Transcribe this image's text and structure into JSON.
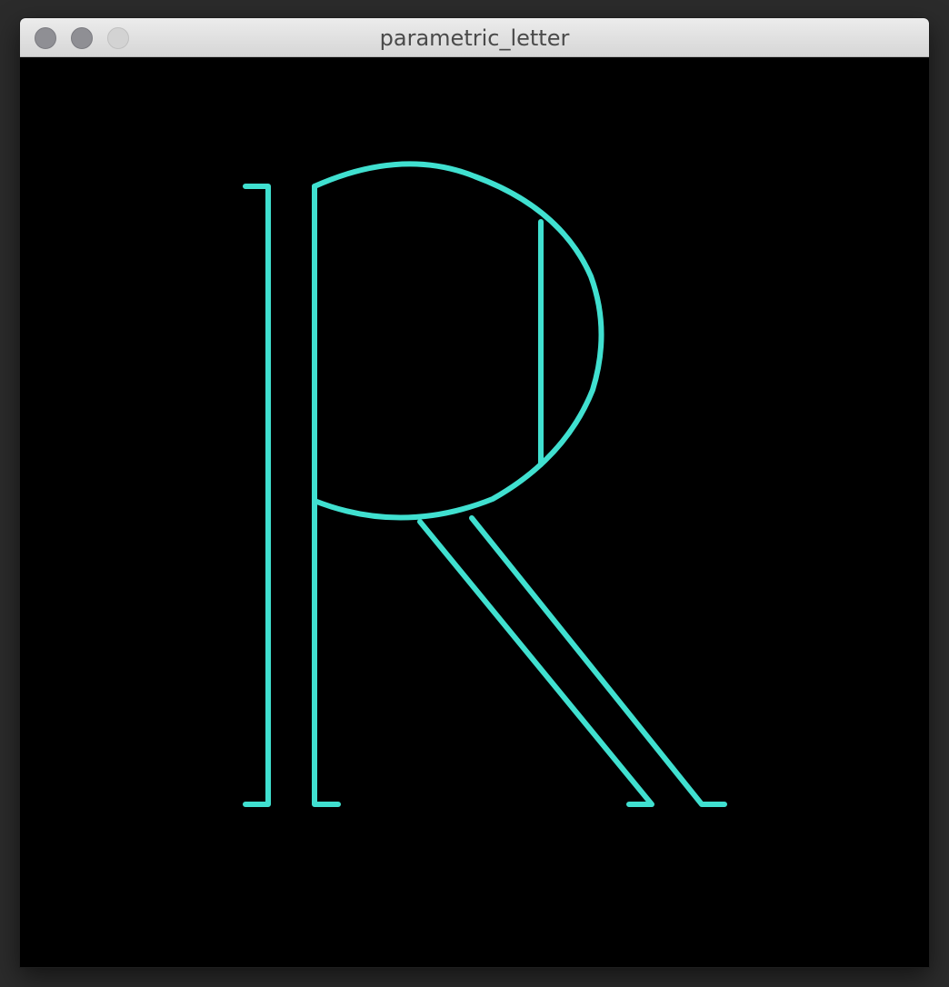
{
  "window": {
    "title": "parametric_letter"
  },
  "colors": {
    "stroke": "#40e0d0",
    "canvas_background": "#000000",
    "titlebar_text": "#4a4a4a"
  },
  "icons": {
    "close": "close-icon",
    "minimize": "minimize-icon",
    "zoom": "zoom-icon"
  }
}
